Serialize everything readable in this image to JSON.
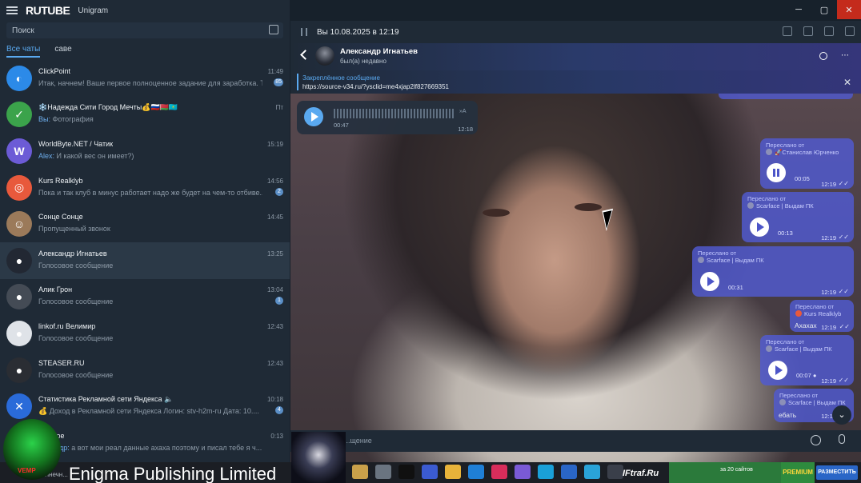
{
  "window": {
    "app_title": "Unigram",
    "overlay_brand": "RUTUBE"
  },
  "sidebar": {
    "search_placeholder": "Поиск",
    "folders": [
      "Все чаты",
      "саве"
    ],
    "chats": [
      {
        "name": "ClickPoint",
        "preview": "Итак, начнем! Ваше первое полноценное задание для заработка. Т...",
        "time": "11:49",
        "badge": "85",
        "avatar_color": "#2c8ae8",
        "avatar_text": "◐"
      },
      {
        "name": "❄️Надежда Сити Город Мечты💰🇷🇺🇧🇾🇰🇿",
        "preview_sender": "Вы:",
        "preview": "Фотография",
        "time": "Пт",
        "avatar_color": "#3ba34b",
        "avatar_text": "✓"
      },
      {
        "name": "WorldByte.NET / Чатик",
        "preview_sender": "Alex:",
        "preview": "И какой вес он имеет?)",
        "time": "15:19",
        "avatar_color": "#6c5bd6",
        "avatar_text": "W"
      },
      {
        "name": "Kurs Realklyb",
        "preview": "Пока и так клуб в минус работает надо же будет на чем-то отбиве...",
        "time": "14:56",
        "badge": "2",
        "avatar_color": "#e8593c",
        "avatar_text": "◎"
      },
      {
        "name": "Сонце Сонце",
        "preview": "Пропущенный звонок",
        "time": "14:45",
        "avatar_color": "#9b7a5a",
        "avatar_text": "☺"
      },
      {
        "name": "Александр Игнатьев",
        "preview": "Голосовое сообщение",
        "time": "13:25",
        "avatar_color": "#222833",
        "avatar_text": "●",
        "active": true
      },
      {
        "name": "Алик Грон",
        "preview": "Голосовое сообщение",
        "time": "13:04",
        "badge": "1",
        "avatar_color": "#444b55",
        "avatar_text": "●"
      },
      {
        "name": "linkof.ru Велимир",
        "preview": "Голосовое сообщение",
        "time": "12:43",
        "avatar_color": "#dfe3e8",
        "avatar_text": "●"
      },
      {
        "name": "STEASER.RU",
        "preview": "Голосовое сообщение",
        "time": "12:43",
        "avatar_color": "#2a2d33",
        "avatar_text": "●"
      },
      {
        "name": "Статистика Рекламной сети Яндекса 🔈",
        "preview": "💰 Доход в Рекламной сети Яндекса  Логин: stv-h2m-ru Дата: 10....",
        "time": "10:18",
        "badge": "4",
        "avatar_color": "#2a6bd9",
        "avatar_text": "✕"
      },
      {
        "name": "...анное",
        "preview_sender": "...ксандр:",
        "preview": "а вот мои реал данные ахаха поэтому и писал тебе я ч...",
        "time": "0:13",
        "avatar_color": "#2b8fe6",
        "avatar_text": "🔖"
      }
    ],
    "last_preview_extra": "солнечн..."
  },
  "player": {
    "now_playing": "Вы 10.08.2025 в 12:19"
  },
  "chat": {
    "name": "Александр Игнатьев",
    "status": "был(а) недавно",
    "pinned_title": "Закреплённое сообщение",
    "pinned_text": "https://source-v34.ru/?ysclid=me4xjap2lf827669351",
    "incoming_voice": {
      "duration": "00:47",
      "time": "12:18",
      "speed": "»A"
    },
    "messages": [
      {
        "forward_label": "Переслано от",
        "forward_from": "🚀Станислав Юрченко",
        "duration": "00:05",
        "time": "12:19",
        "state": "pause"
      },
      {
        "forward_label": "Переслано от",
        "forward_from": "Scarface | Выдам ПК",
        "duration": "00:13",
        "time": "12:19",
        "state": "play"
      },
      {
        "forward_label": "Переслано от",
        "forward_from": "Scarface | Выдам ПК",
        "duration": "00:31",
        "time": "12:19",
        "state": "play"
      },
      {
        "forward_label": "Переслано от",
        "forward_from": "Kurs Realklyb",
        "text": "Ахахах",
        "time": "12:19"
      },
      {
        "forward_label": "Переслано от",
        "forward_from": "Scarface | Выдам ПК",
        "duration": "00:07 ●",
        "time": "12:19",
        "state": "play"
      },
      {
        "forward_label": "Переслано от",
        "forward_from": "Scarface | Выдам ПК",
        "text": "ебать",
        "time": "12:19"
      }
    ],
    "input_placeholder": "...щение"
  },
  "taskbar": {
    "overlay_text": "Enigma Publishing Limited",
    "iftraf": "IFtraf.Ru",
    "ad_text": "за 20 сайтов",
    "premium": "PREMIUM",
    "place_button": "РАЗМЕСТИТЬ",
    "logo_text": "VEMP"
  },
  "colors": {
    "sidebar_bg": "#1f2a36",
    "accent": "#5aa9f0",
    "bubble_out": "#505ad2",
    "close": "#c42b1c"
  }
}
